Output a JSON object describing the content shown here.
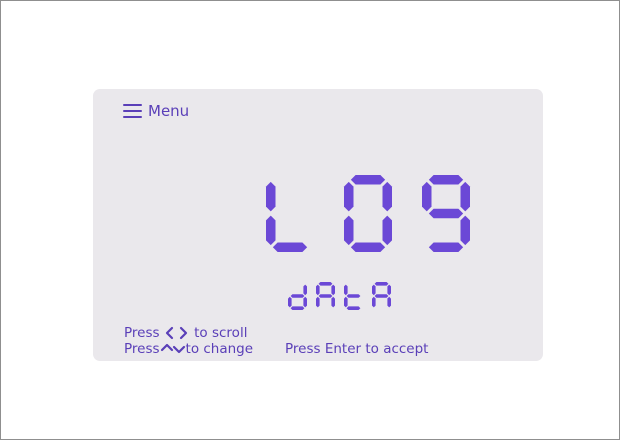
{
  "menu": {
    "label": "Menu",
    "icon": "hamburger-icon"
  },
  "display": {
    "main_text": "LO9",
    "sub_text": "dAtA",
    "segment_color": "#6b48d6"
  },
  "hints": {
    "scroll_prefix": "Press",
    "scroll_suffix": "to scroll",
    "change_prefix": "Press",
    "change_suffix": "to change",
    "accept": "Press Enter to accept",
    "scroll_icon": "left-right-chevrons-icon",
    "change_icon": "up-down-chevrons-icon"
  },
  "colors": {
    "lcd_background": "#eae8ec",
    "text": "#5a3fb8",
    "frame_border": "#8f8f8f"
  }
}
